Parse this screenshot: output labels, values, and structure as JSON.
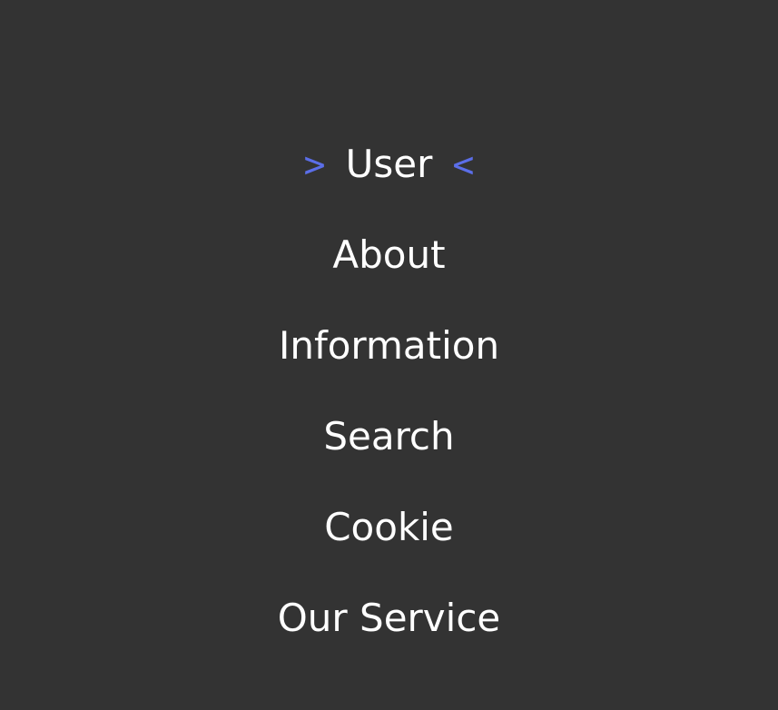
{
  "menu": {
    "active_marker_left": ">",
    "active_marker_right": "<",
    "accent_color": "#5b6ee8",
    "text_color": "#ffffff",
    "background_color": "#333333",
    "active_index": 0,
    "items": [
      {
        "label": "User"
      },
      {
        "label": "About"
      },
      {
        "label": "Information"
      },
      {
        "label": "Search"
      },
      {
        "label": "Cookie"
      },
      {
        "label": "Our Service"
      }
    ]
  }
}
